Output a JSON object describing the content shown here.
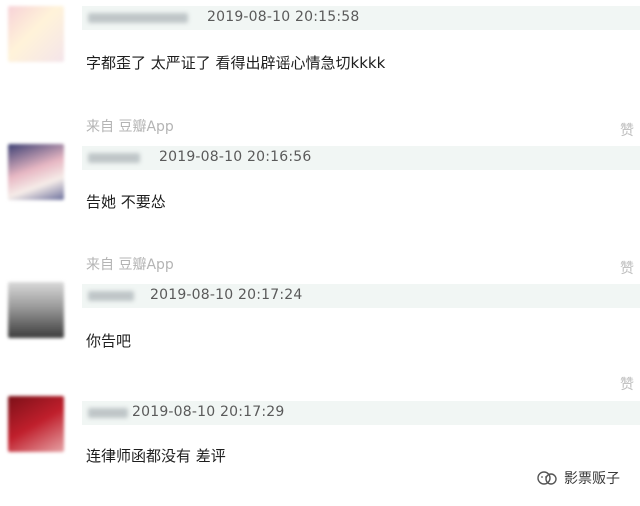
{
  "comments": [
    {
      "timestamp": "2019-08-10 20:15:58",
      "content": "字都歪了 太严证了 看得出辟谣心情急切kkkk",
      "source": "来自 豆瓣App",
      "like_label": "赞"
    },
    {
      "timestamp": "2019-08-10 20:16:56",
      "content": "告她 不要怂",
      "source": "来自 豆瓣App",
      "like_label": "赞"
    },
    {
      "timestamp": "2019-08-10 20:17:24",
      "content": "你告吧",
      "like_label": "赞"
    },
    {
      "timestamp": "2019-08-10 20:17:29",
      "content": "连律师函都没有 差评"
    }
  ],
  "watermark": {
    "text": "影票贩子",
    "icon": "wechat-official-account-icon"
  }
}
